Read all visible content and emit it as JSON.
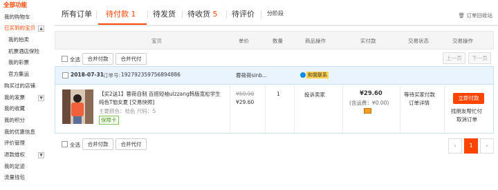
{
  "sidebar": {
    "header": "全部功能",
    "items": [
      {
        "label": "我的购物车"
      },
      {
        "label": "已买到的宝贝"
      },
      {
        "label": "我的拍卖"
      },
      {
        "label": "机票酒店保险"
      },
      {
        "label": "我的彩票"
      },
      {
        "label": "官方集运"
      },
      {
        "label": "购买过的店铺"
      },
      {
        "label": "我的发票"
      },
      {
        "label": "我的收藏"
      },
      {
        "label": "我的积分"
      },
      {
        "label": "我的优惠信息"
      },
      {
        "label": "评价管理"
      },
      {
        "label": "退款维权"
      },
      {
        "label": "我的足迹"
      },
      {
        "label": "流量钱包"
      }
    ]
  },
  "tabs": [
    {
      "label": "所有订单",
      "count": ""
    },
    {
      "label": "待付款",
      "count": "1"
    },
    {
      "label": "待发货",
      "count": ""
    },
    {
      "label": "待收货",
      "count": "5"
    },
    {
      "label": "待评价",
      "count": ""
    },
    {
      "label": "分阶段",
      "count": ""
    }
  ],
  "recycle_label": "订单回收站",
  "table_headers": [
    "宝贝",
    "单价",
    "数量",
    "商品操作",
    "实付款",
    "交易状态",
    "交易操作"
  ],
  "bulk": {
    "select_all": "全选",
    "merge_pay": "合并付款",
    "merge_proxy": "合并代付"
  },
  "pagination": {
    "prev": "上一页",
    "next": "下一页",
    "current": "1"
  },
  "order": {
    "date": "2018-07-31",
    "order_no_label": "订单号:",
    "order_no": "192792359756894886",
    "shop": "蓉荷荷sinb...",
    "contact": "和我联系",
    "product_title_1": "【买2送1】蓉荷自制 百搭短袖ulzzang韩版宽松学生",
    "product_title_2": "纯色T恤女夏 [交易快照]",
    "attrs": "主要颜色：桔色  尺码：S",
    "badge": "保障卡",
    "orig_price": "¥59.90",
    "price": "¥29.60",
    "qty": "1",
    "complaint": "投诉卖家",
    "total": "¥29.60",
    "shipping": "(含运费：¥0.00)",
    "status_1": "等待买家付款",
    "status_2": "订单详情",
    "pay_btn": "立即付款",
    "action_1": "找朋友帮忙付",
    "action_2": "取消订单"
  }
}
